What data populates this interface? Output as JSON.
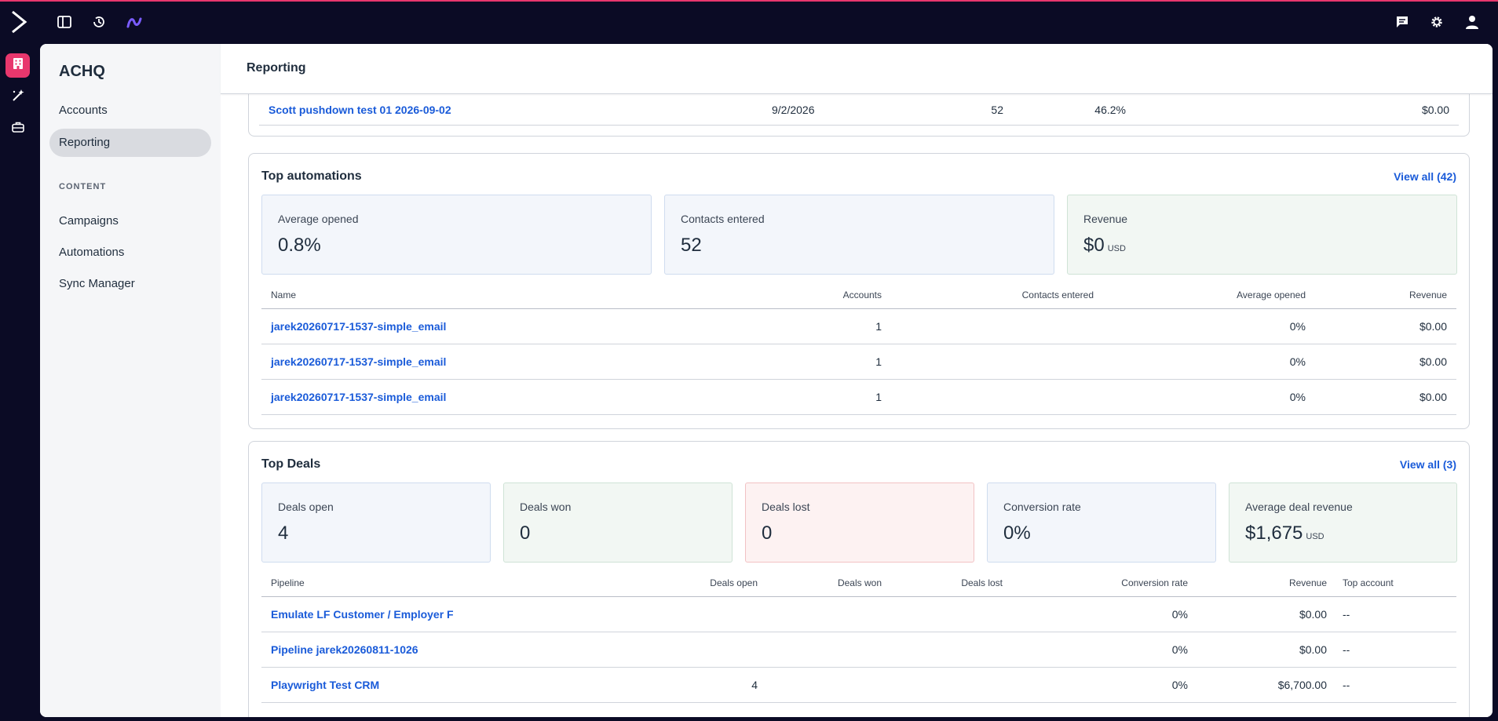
{
  "app": {
    "sidebar_title": "ACHQ",
    "page_title": "Reporting",
    "accent_color": "#e8376d"
  },
  "topbar": {
    "icons_left": [
      "logo-chevron-icon",
      "sidebar-toggle-icon",
      "history-icon",
      "brand-logo-icon"
    ],
    "icons_right": [
      "chat-icon",
      "gear-icon",
      "user-icon"
    ]
  },
  "rail": {
    "items": [
      "building-icon",
      "magic-wand-icon",
      "briefcase-icon"
    ]
  },
  "sidenav": {
    "items": [
      {
        "label": "Accounts",
        "active": false
      },
      {
        "label": "Reporting",
        "active": true
      }
    ],
    "section_label": "CONTENT",
    "content_items": [
      {
        "label": "Campaigns"
      },
      {
        "label": "Automations"
      },
      {
        "label": "Sync Manager"
      }
    ]
  },
  "previous_row": {
    "name": "Scott pushdown test 01 2026-09-02",
    "date": "9/2/2026",
    "count": "52",
    "percent": "46.2%",
    "revenue": "$0.00"
  },
  "automations": {
    "title": "Top automations",
    "view_all": "View all (42)",
    "stats": [
      {
        "label": "Average opened",
        "value": "0.8%",
        "unit": ""
      },
      {
        "label": "Contacts entered",
        "value": "52",
        "unit": ""
      },
      {
        "label": "Revenue",
        "value": "$0",
        "unit": "USD"
      }
    ],
    "columns": [
      "Name",
      "Accounts",
      "Contacts entered",
      "Average opened",
      "Revenue"
    ],
    "rows": [
      {
        "name": "jarek20260717-1537-simple_email",
        "accounts": "1",
        "contacts": "",
        "opened": "0%",
        "revenue": "$0.00"
      },
      {
        "name": "jarek20260717-1537-simple_email",
        "accounts": "1",
        "contacts": "",
        "opened": "0%",
        "revenue": "$0.00"
      },
      {
        "name": "jarek20260717-1537-simple_email",
        "accounts": "1",
        "contacts": "",
        "opened": "0%",
        "revenue": "$0.00"
      }
    ]
  },
  "deals": {
    "title": "Top Deals",
    "view_all": "View all (3)",
    "stats": [
      {
        "label": "Deals open",
        "value": "4",
        "unit": ""
      },
      {
        "label": "Deals won",
        "value": "0",
        "unit": ""
      },
      {
        "label": "Deals lost",
        "value": "0",
        "unit": ""
      },
      {
        "label": "Conversion rate",
        "value": "0%",
        "unit": ""
      },
      {
        "label": "Average deal revenue",
        "value": "$1,675",
        "unit": "USD"
      }
    ],
    "columns": [
      "Pipeline",
      "Deals open",
      "Deals won",
      "Deals lost",
      "Conversion rate",
      "Revenue",
      "Top account"
    ],
    "rows": [
      {
        "pipeline": "Emulate LF Customer / Employer F",
        "open": "",
        "won": "",
        "lost": "",
        "conversion": "0%",
        "revenue": "$0.00",
        "top_account": "--"
      },
      {
        "pipeline": "Pipeline jarek20260811-1026",
        "open": "",
        "won": "",
        "lost": "",
        "conversion": "0%",
        "revenue": "$0.00",
        "top_account": "--"
      },
      {
        "pipeline": "Playwright Test CRM",
        "open": "4",
        "won": "",
        "lost": "",
        "conversion": "0%",
        "revenue": "$6,700.00",
        "top_account": "--"
      }
    ]
  }
}
